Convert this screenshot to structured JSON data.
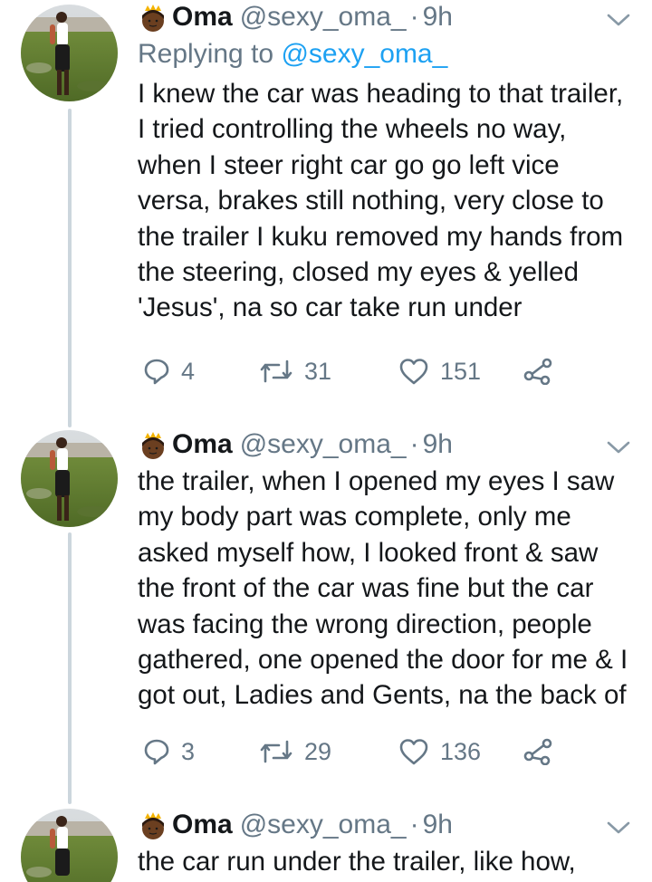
{
  "tweets": [
    {
      "display_name": "Oma",
      "handle": "@sexy_oma_",
      "separator": "·",
      "time": "9h",
      "replying_label": "Replying to",
      "replying_to": "@sexy_oma_",
      "text": "I knew the car was heading to that trailer,\nI tried controlling the wheels no way,\nwhen I steer right car go go left vice\nversa, brakes still nothing, very close to\nthe trailer I kuku removed my hands from\nthe steering, closed my eyes & yelled\n'Jesus', na so car take run under",
      "replies": "4",
      "retweets": "31",
      "likes": "151"
    },
    {
      "display_name": "Oma",
      "handle": "@sexy_oma_",
      "separator": "·",
      "time": "9h",
      "text": "the trailer, when I opened my eyes I saw\nmy body part was complete, only me\nasked myself how, I looked front & saw\nthe front of the car was fine but the car\nwas facing the wrong direction, people\ngathered, one opened the door for me & I\ngot out, Ladies and Gents, na the back of",
      "replies": "3",
      "retweets": "29",
      "likes": "136"
    },
    {
      "display_name": "Oma",
      "handle": "@sexy_oma_",
      "separator": "·",
      "time": "9h",
      "text": "the car run under the trailer, like how,"
    }
  ],
  "icons": {
    "reply": "reply-icon",
    "retweet": "retweet-icon",
    "like": "heart-icon",
    "share": "share-icon",
    "chevron": "chevron-down-icon",
    "crown_face": "princess-emoji-icon"
  },
  "colors": {
    "secondary_text": "#657786",
    "mention": "#1da1f2",
    "thread_line": "#ccd6dd",
    "primary_text": "#14171a"
  }
}
